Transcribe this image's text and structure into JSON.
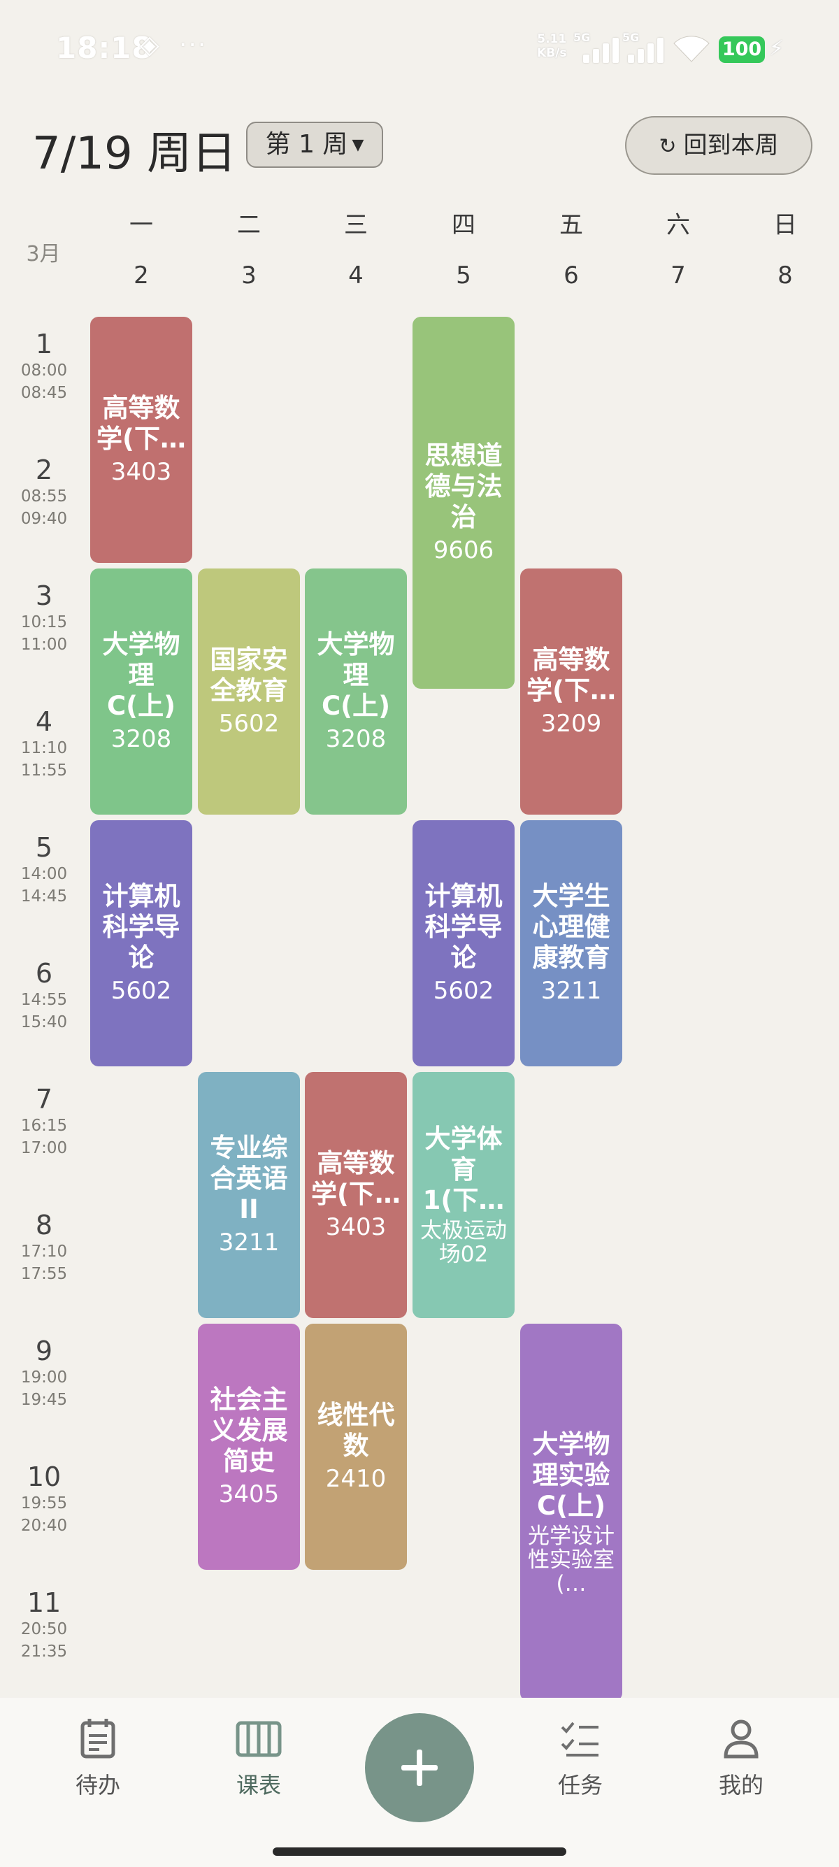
{
  "status_bar": {
    "time": "18:18",
    "speed_value": "5.11",
    "speed_unit": "KB/s",
    "signal1_label": "5G",
    "signal2_label": "5G",
    "battery": "100",
    "icons": [
      "nfc-icon",
      "more-dots-icon",
      "signal-icon",
      "wifi-icon",
      "battery-icon",
      "charging-bolt-icon"
    ]
  },
  "header": {
    "date": "7/19 周日",
    "week_selector": "第 1 周",
    "back_button": "回到本周"
  },
  "month_label": "3月",
  "days": [
    {
      "weekday": "一",
      "date": "2"
    },
    {
      "weekday": "二",
      "date": "3"
    },
    {
      "weekday": "三",
      "date": "4"
    },
    {
      "weekday": "四",
      "date": "5"
    },
    {
      "weekday": "五",
      "date": "6"
    },
    {
      "weekday": "六",
      "date": "7"
    },
    {
      "weekday": "日",
      "date": "8"
    }
  ],
  "periods": [
    {
      "num": "1",
      "start": "08:00",
      "end": "08:45"
    },
    {
      "num": "2",
      "start": "08:55",
      "end": "09:40"
    },
    {
      "num": "3",
      "start": "10:15",
      "end": "11:00"
    },
    {
      "num": "4",
      "start": "11:10",
      "end": "11:55"
    },
    {
      "num": "5",
      "start": "14:00",
      "end": "14:45"
    },
    {
      "num": "6",
      "start": "14:55",
      "end": "15:40"
    },
    {
      "num": "7",
      "start": "16:15",
      "end": "17:00"
    },
    {
      "num": "8",
      "start": "17:10",
      "end": "17:55"
    },
    {
      "num": "9",
      "start": "19:00",
      "end": "19:45"
    },
    {
      "num": "10",
      "start": "19:55",
      "end": "20:40"
    },
    {
      "num": "11",
      "start": "20:50",
      "end": "21:35"
    }
  ],
  "courses": [
    {
      "name": "高等数学(下…",
      "room": "3403",
      "color": "#c0706f"
    },
    {
      "name": "大学物理C(上)",
      "room": "3208",
      "color": "#7fc58a"
    },
    {
      "name": "计算机科学导论",
      "room": "5602",
      "color": "#7e73bf"
    },
    {
      "name": "国家安全教育",
      "room": "5602",
      "color": "#bec87c"
    },
    {
      "name": "专业综合英语II",
      "room": "3211",
      "color": "#7fb1c2"
    },
    {
      "name": "社会主义发展简史",
      "room": "3405",
      "color": "#bc77c0"
    },
    {
      "name": "大学物理C(上)",
      "room": "3208",
      "color": "#85c58c"
    },
    {
      "name": "高等数学(下…",
      "room": "3403",
      "color": "#c07270"
    },
    {
      "name": "线性代数",
      "room": "2410",
      "color": "#c2a274"
    },
    {
      "name": "思想道德与法治",
      "room": "9606",
      "color": "#98c47a"
    },
    {
      "name": "计算机科学导论",
      "room": "5602",
      "color": "#7e73bf"
    },
    {
      "name": "大学体育1(下…",
      "room": "太极运动场02",
      "color": "#86c8b2"
    },
    {
      "name": "高等数学(下…",
      "room": "3209",
      "color": "#c07270"
    },
    {
      "name": "大学生心理健康教育",
      "room": "3211",
      "color": "#7690c4"
    },
    {
      "name": "大学物理实验C(上)",
      "room": "光学设计性实验室(…",
      "color": "#a177c4"
    }
  ],
  "bottom_nav": {
    "todo": "待办",
    "timetable": "课表",
    "tasks": "任务",
    "mine": "我的"
  }
}
